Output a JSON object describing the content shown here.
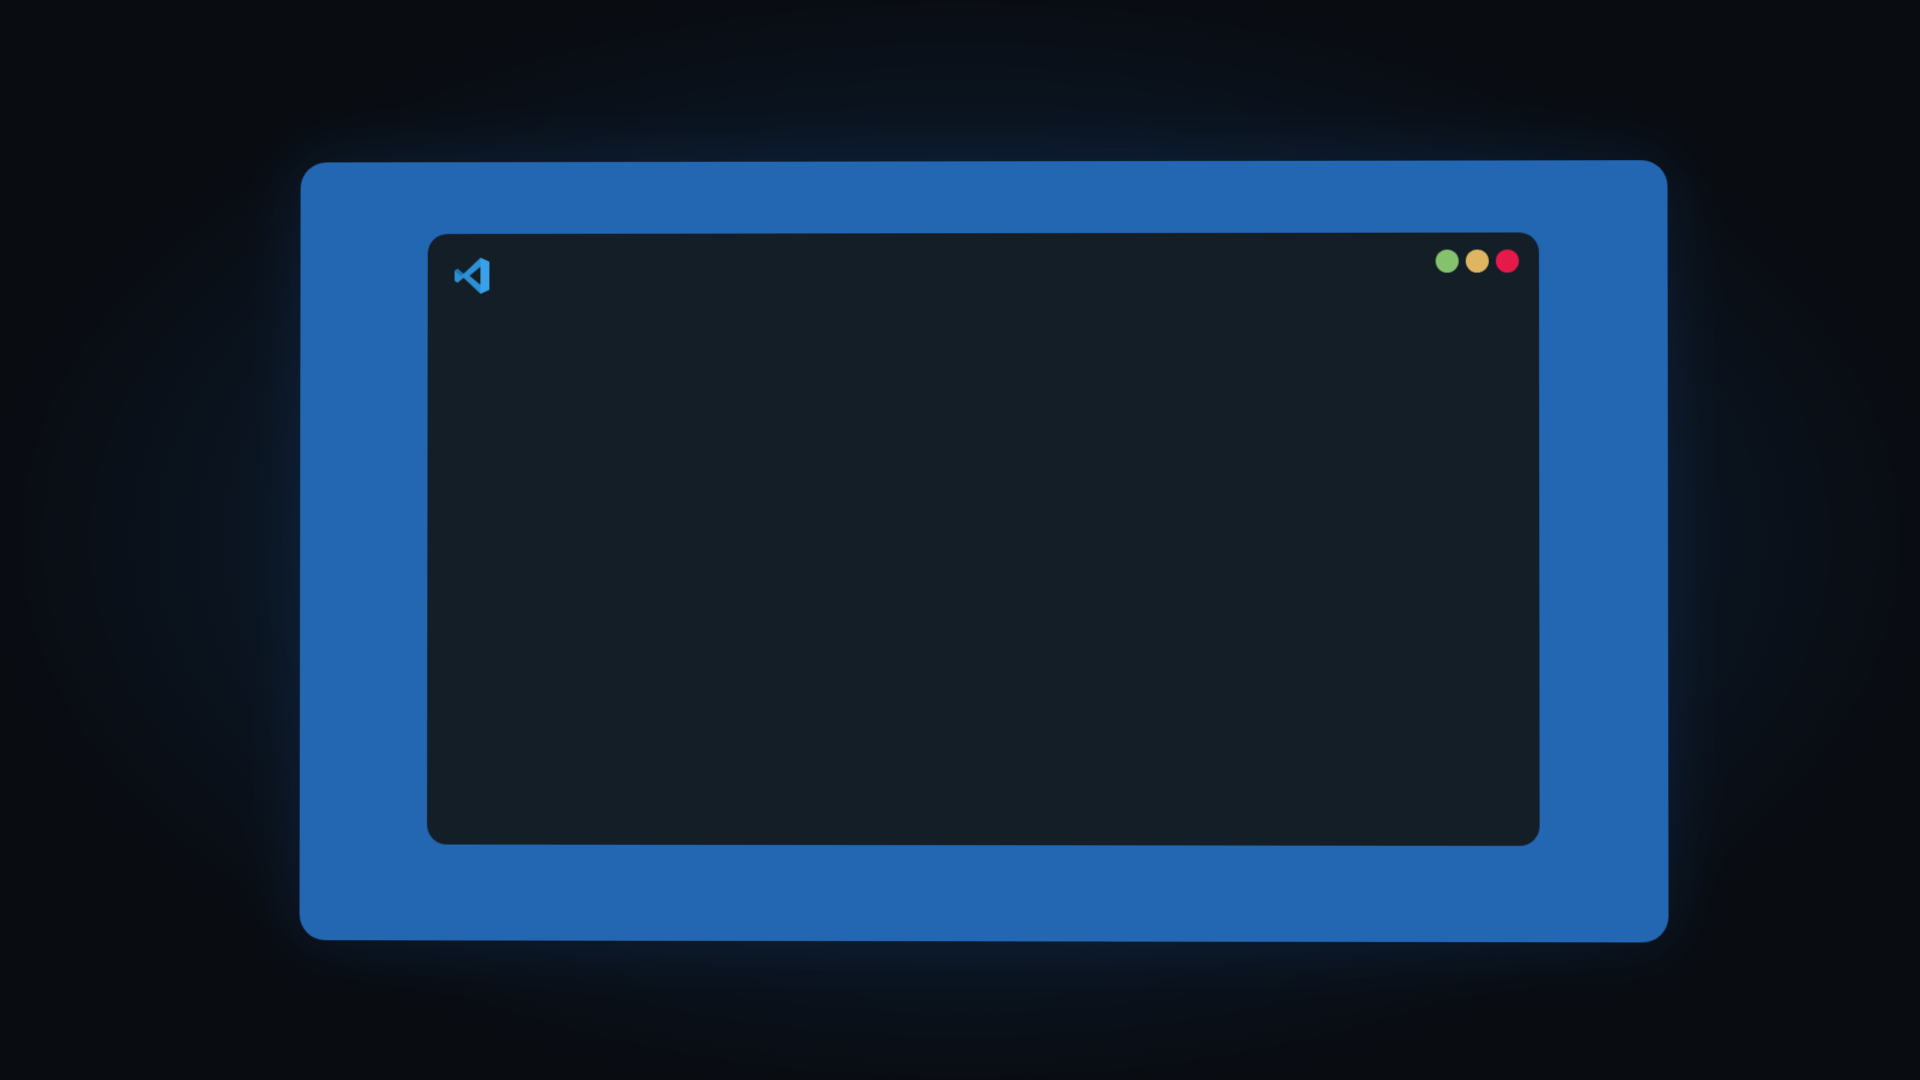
{
  "app": {
    "logo_icon": "vscode-logo-icon",
    "logo_color": "#2d8fd6"
  },
  "window_controls": [
    {
      "icon": "green-dot-icon",
      "color": "#86c26e"
    },
    {
      "icon": "yellow-dot-icon",
      "color": "#e0b562"
    },
    {
      "icon": "red-dot-icon",
      "color": "#e5194a"
    }
  ],
  "colors": {
    "page_background": "#090c11",
    "backdrop_glow": "#16355a",
    "frame": "#2366b2",
    "window": "#131e27"
  }
}
